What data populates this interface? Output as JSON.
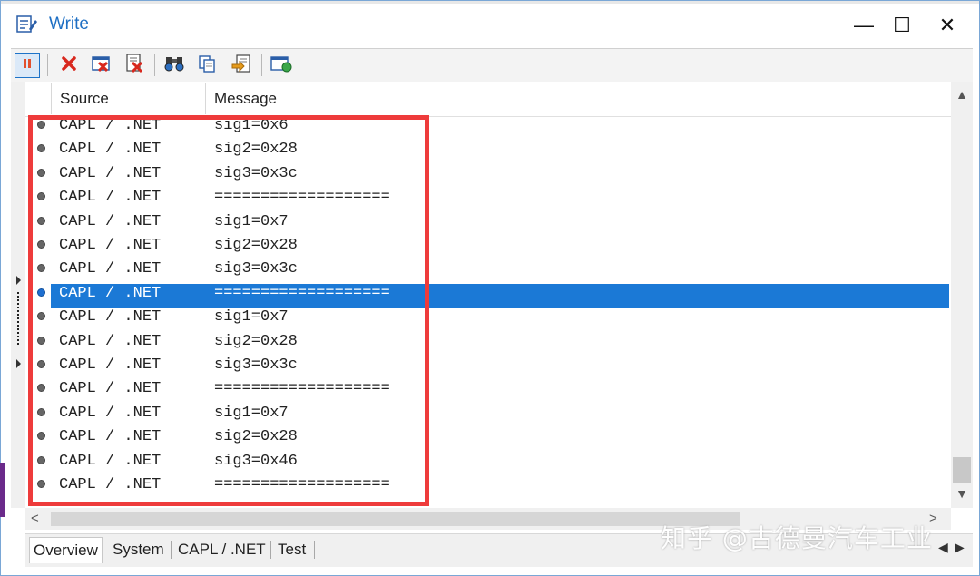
{
  "window": {
    "title": "Write",
    "minimize_glyph": "—",
    "maximize_glyph": "☐",
    "close_glyph": "✕",
    "icon": "write-window-icon"
  },
  "toolbar": {
    "buttons": [
      {
        "name": "pause-button",
        "icon": "pause-icon"
      },
      {
        "name": "clear-button",
        "icon": "red-x-icon"
      },
      {
        "name": "clear-all-button",
        "icon": "clear-window-icon"
      },
      {
        "name": "delete-page-button",
        "icon": "delete-page-icon"
      },
      {
        "name": "find-button",
        "icon": "binoculars-icon"
      },
      {
        "name": "copy-button",
        "icon": "copy-icon"
      },
      {
        "name": "export-button",
        "icon": "export-icon"
      },
      {
        "name": "options-button",
        "icon": "window-settings-icon"
      }
    ],
    "accent": "#1e73c8"
  },
  "grid": {
    "columns": [
      "Source",
      "Message"
    ],
    "selected_row": 7,
    "selection_color": "#1b79d6",
    "rows": [
      {
        "source": "CAPL / .NET",
        "message": "sig1=0x6"
      },
      {
        "source": "CAPL / .NET",
        "message": "sig2=0x28"
      },
      {
        "source": "CAPL / .NET",
        "message": "sig3=0x3c"
      },
      {
        "source": "CAPL / .NET",
        "message": "==================="
      },
      {
        "source": "CAPL / .NET",
        "message": "sig1=0x7"
      },
      {
        "source": "CAPL / .NET",
        "message": "sig2=0x28"
      },
      {
        "source": "CAPL / .NET",
        "message": "sig3=0x3c"
      },
      {
        "source": "CAPL / .NET",
        "message": "==================="
      },
      {
        "source": "CAPL / .NET",
        "message": "sig1=0x7"
      },
      {
        "source": "CAPL / .NET",
        "message": "sig2=0x28"
      },
      {
        "source": "CAPL / .NET",
        "message": "sig3=0x3c"
      },
      {
        "source": "CAPL / .NET",
        "message": "==================="
      },
      {
        "source": "CAPL / .NET",
        "message": "sig1=0x7"
      },
      {
        "source": "CAPL / .NET",
        "message": "sig2=0x28"
      },
      {
        "source": "CAPL / .NET",
        "message": "sig3=0x46"
      },
      {
        "source": "CAPL / .NET",
        "message": "==================="
      }
    ]
  },
  "scrollbars": {
    "up": "▲",
    "down": "▼",
    "left": "<",
    "right": ">"
  },
  "tabs": [
    {
      "label": "Overview",
      "active": true
    },
    {
      "label": "System",
      "active": false
    },
    {
      "label": "CAPL / .NET",
      "active": false
    },
    {
      "label": "Test",
      "active": false
    }
  ],
  "tab_nav": {
    "prev": "◀",
    "next": "▶"
  },
  "annotation": {
    "highlight_color": "#ee3b3b"
  },
  "watermark": {
    "text": "知乎 @古德曼汽车工业"
  }
}
